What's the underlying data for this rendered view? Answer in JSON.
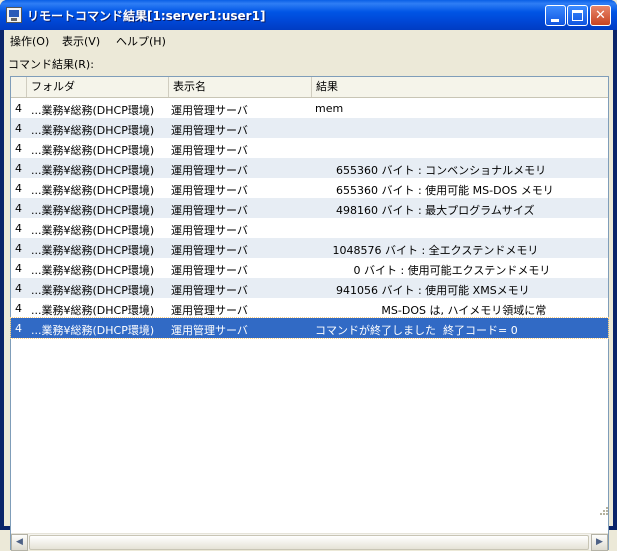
{
  "window": {
    "title": "リモートコマンド結果[1:server1:user1]"
  },
  "menu": [
    {
      "label": "操作(O)"
    },
    {
      "label": "表示(V)"
    },
    {
      "label": "ヘルプ(H)"
    }
  ],
  "results_label": "コマンド結果(R):",
  "table": {
    "columns": [
      "",
      "フォルダ",
      "表示名",
      "結果"
    ],
    "rows": [
      {
        "num": "4",
        "folder": "...業務¥総務(DHCP環境)",
        "name": "運用管理サーバ",
        "result": "mem"
      },
      {
        "num": "4",
        "folder": "...業務¥総務(DHCP環境)",
        "name": "運用管理サーバ",
        "result": ""
      },
      {
        "num": "4",
        "folder": "...業務¥総務(DHCP環境)",
        "name": "運用管理サーバ",
        "result": ""
      },
      {
        "num": "4",
        "folder": "...業務¥総務(DHCP環境)",
        "name": "運用管理サーバ",
        "result": "      655360 バイト : コンベンショナルメモリ"
      },
      {
        "num": "4",
        "folder": "...業務¥総務(DHCP環境)",
        "name": "運用管理サーバ",
        "result": "      655360 バイト : 使用可能 MS-DOS メモリ"
      },
      {
        "num": "4",
        "folder": "...業務¥総務(DHCP環境)",
        "name": "運用管理サーバ",
        "result": "      498160 バイト : 最大プログラムサイズ"
      },
      {
        "num": "4",
        "folder": "...業務¥総務(DHCP環境)",
        "name": "運用管理サーバ",
        "result": ""
      },
      {
        "num": "4",
        "folder": "...業務¥総務(DHCP環境)",
        "name": "運用管理サーバ",
        "result": "     1048576 バイト : 全エクステンドメモリ"
      },
      {
        "num": "4",
        "folder": "...業務¥総務(DHCP環境)",
        "name": "運用管理サーバ",
        "result": "           0 バイト : 使用可能エクステンドメモリ"
      },
      {
        "num": "4",
        "folder": "...業務¥総務(DHCP環境)",
        "name": "運用管理サーバ",
        "result": "      941056 バイト : 使用可能 XMSメモリ"
      },
      {
        "num": "4",
        "folder": "...業務¥総務(DHCP環境)",
        "name": "運用管理サーバ",
        "result": "                   MS-DOS は, ハイメモリ領域に常"
      },
      {
        "num": "4",
        "folder": "...業務¥総務(DHCP環境)",
        "name": "運用管理サーバ",
        "result": "コマンドが終了しました  終了コード= 0"
      }
    ],
    "selected_row": 11
  },
  "colors": {
    "title_bar": "#0055E5",
    "selection": "#316AC5",
    "alt_row": "#E7EDF4"
  }
}
